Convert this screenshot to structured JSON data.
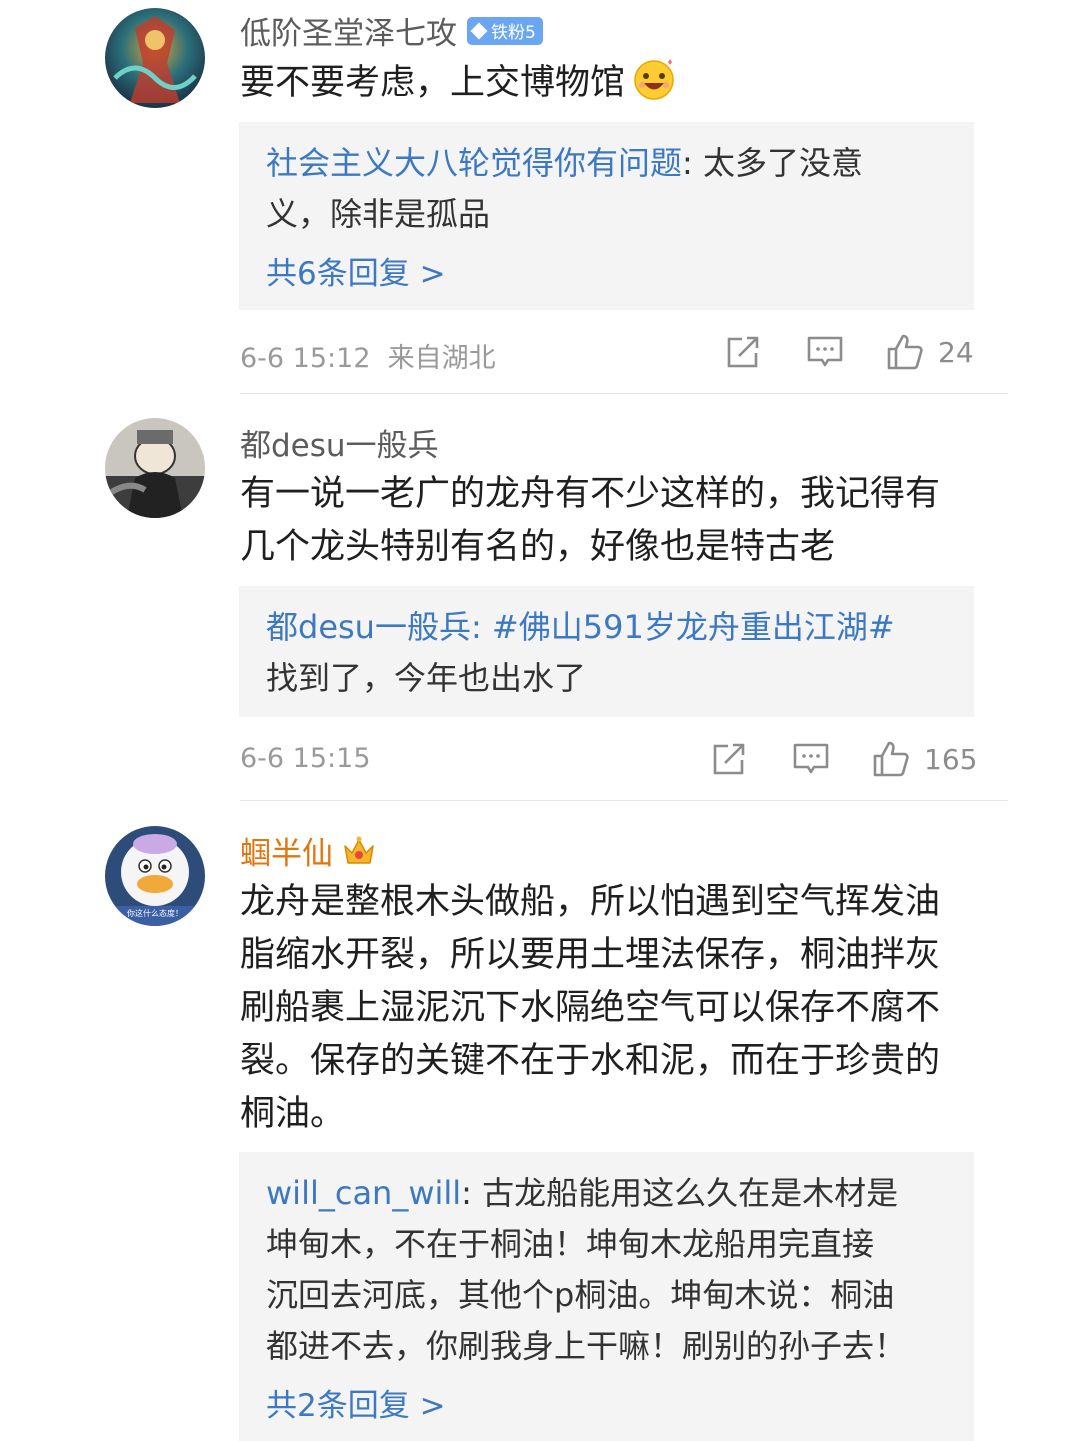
{
  "comments": [
    {
      "username": "低阶圣堂泽七攻",
      "badge": "铁粉5",
      "content": "要不要考虑，上交博物馆",
      "reply": {
        "user": "社会主义大八轮觉得你有问题",
        "text_line1": "太多了没意",
        "text_line2": "义，除非是孤品",
        "more": "共6条回复 >"
      },
      "time": "6-6 15:12",
      "location": "来自湖北",
      "likes": "24"
    },
    {
      "username": "都desu一般兵",
      "content_line1": "有一说一老广的龙舟有不少这样的，我记得有",
      "content_line2": "几个龙头特别有名的，好像也是特古老",
      "reply": {
        "user": "都desu一般兵",
        "tag": "#佛山591岁龙舟重出江湖#",
        "text_line2": "找到了，今年也出水了"
      },
      "time": "6-6 15:15",
      "likes": "165"
    },
    {
      "username": "蝈半仙",
      "content_lines": [
        "龙舟是整根木头做船，所以怕遇到空气挥发油",
        "脂缩水开裂，所以要用土埋法保存，桐油拌灰",
        "刷船裹上湿泥沉下水隔绝空气可以保存不腐不",
        "裂。保存的关键不在于水和泥，而在于珍贵的",
        "桐油。"
      ],
      "avatar_text": "你这什么态度！",
      "reply": {
        "user": "will_can_will",
        "lines": [
          "古龙船能用这么久在是木材是",
          "坤甸木，不在于桐油！坤甸木龙船用完直接",
          "沉回去河底，其他个p桐油。坤甸木说：桐油",
          "都进不去，你刷我身上干嘛！刷别的孙子去！"
        ],
        "more": "共2条回复 >"
      }
    }
  ],
  "icons": [
    "share-icon",
    "comment-icon",
    "like-icon"
  ],
  "colors": {
    "link": "#3d79c2",
    "vip": "#e3740e",
    "badge": "#6aa6f2",
    "reply_bg": "#f4f4f4"
  }
}
